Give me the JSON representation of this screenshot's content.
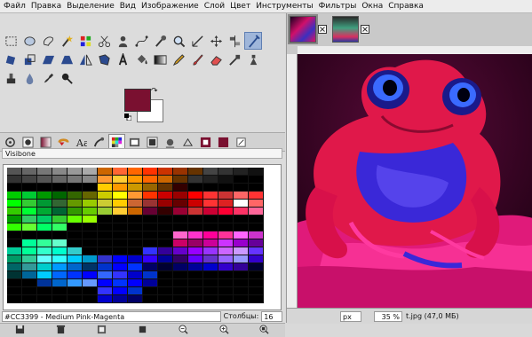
{
  "menubar": {
    "items": [
      "Файл",
      "Правка",
      "Выделение",
      "Вид",
      "Изображение",
      "Слой",
      "Цвет",
      "Инструменты",
      "Фильтры",
      "Окна",
      "Справка"
    ]
  },
  "colors": {
    "foreground": "#7a1030",
    "background": "#ffffff",
    "active_tool_highlight": "#9fb6da"
  },
  "toolbox": {
    "row1_icons": [
      "rect-select-icon",
      "ellipse-select-icon",
      "free-select-icon",
      "fuzzy-select-icon",
      "select-by-color-icon",
      "scissors-icon",
      "foreground-select-icon",
      "paths-icon",
      "color-picker-icon",
      "zoom-icon",
      "measure-icon",
      "move-icon",
      "align-icon",
      "crop-icon"
    ],
    "row2_icons": [
      "rotate-icon",
      "scale-icon",
      "shear-icon",
      "perspective-icon",
      "flip-icon",
      "cage-icon",
      "text-icon",
      "bucket-fill-icon",
      "blend-icon",
      "pencil-icon",
      "paintbrush-icon",
      "eraser-icon",
      "airbrush-icon",
      "ink-icon"
    ],
    "row3_icons": [
      "clone-icon",
      "heal-icon",
      "smudge-icon",
      "dodge-burn-icon"
    ]
  },
  "dock_tabs": [
    "tool-options-tab",
    "brushes-tab",
    "patterns-tab",
    "gradients-tab",
    "palettes-tab",
    "fonts-tab",
    "document-history-tab",
    "images-tab",
    "channels-tab",
    "layers-tab",
    "paths-tab",
    "undo-tab",
    "colors-tab",
    "pointer-tab",
    "sample-points-tab"
  ],
  "palette": {
    "name": "Visibone",
    "selected_color_name": "#CC3399 - Medium Pink-Magenta",
    "columns_label": "Столбцы:",
    "columns_value": "16",
    "columns_count": 17,
    "colors": [
      "#555555",
      "#666666",
      "#777777",
      "#888888",
      "#999999",
      "#aaaaaa",
      "#cc6600",
      "#ff6633",
      "#ff6600",
      "#ff3300",
      "#cc3300",
      "#993300",
      "#663300",
      "#444444",
      "#333333",
      "#222222",
      "#111111",
      "#333333",
      "#444444",
      "#555555",
      "#666666",
      "#777777",
      "#888888",
      "#ff9933",
      "#ffcc33",
      "#ff9900",
      "#ff6600",
      "#cc6600",
      "#663300",
      "#333333",
      "#222222",
      "#111111",
      "#000000",
      "#000000",
      "#000000",
      "#000000",
      "#000000",
      "#000000",
      "#000000",
      "#000000",
      "#ffcc00",
      "#ff9900",
      "#cc9900",
      "#996600",
      "#663300",
      "#330000",
      "#000000",
      "#000000",
      "#000000",
      "#000000",
      "#000000",
      "#00cc00",
      "#00cc33",
      "#009900",
      "#006600",
      "#336600",
      "#666600",
      "#cccc00",
      "#ffff00",
      "#ff9933",
      "#ff3300",
      "#cc0000",
      "#990000",
      "#ff0000",
      "#ff3333",
      "#cc3333",
      "#ff6666",
      "#ff3333",
      "#00ff00",
      "#33cc33",
      "#009933",
      "#336633",
      "#669900",
      "#99cc00",
      "#cccc33",
      "#ffcc00",
      "#cc6633",
      "#993333",
      "#990000",
      "#660000",
      "#cc0000",
      "#ff3333",
      "#dd2222",
      "#ffffff",
      "#ff6666",
      "#33cc00",
      "#00ff33",
      "#00aa33",
      "#006633",
      "#339900",
      "#66cc00",
      "#99cc33",
      "#ffcc33",
      "#cc6600",
      "#660033",
      "#330000",
      "#990033",
      "#cc3333",
      "#cc0033",
      "#ff0033",
      "#ff3366",
      "#ff6699",
      "#009900",
      "#33cc66",
      "#00cc66",
      "#33cc33",
      "#66ff00",
      "#99ff00",
      "#000000",
      "#000000",
      "#000000",
      "#000000",
      "#000000",
      "#000000",
      "#000000",
      "#000000",
      "#000000",
      "#000000",
      "#000000",
      "#33ff00",
      "#66ff33",
      "#00ff66",
      "#33ff66",
      "#000000",
      "#000000",
      "#000000",
      "#000000",
      "#000000",
      "#000000",
      "#000000",
      "#000000",
      "#000000",
      "#000000",
      "#000000",
      "#000000",
      "#000000",
      "#000000",
      "#000000",
      "#000000",
      "#000000",
      "#000000",
      "#000000",
      "#000000",
      "#000000",
      "#000000",
      "#000000",
      "#000000",
      "#ff66cc",
      "#ff33cc",
      "#ff0099",
      "#ff3399",
      "#ff66ff",
      "#cc33cc",
      "#000000",
      "#00ff99",
      "#33ff99",
      "#66ffcc",
      "#000000",
      "#000000",
      "#000000",
      "#000000",
      "#000000",
      "#000000",
      "#000000",
      "#cc0066",
      "#990066",
      "#cc0099",
      "#cc33ff",
      "#9900cc",
      "#660099",
      "#00cc99",
      "#00ff99",
      "#33ffcc",
      "#00ffcc",
      "#33cccc",
      "#000000",
      "#000000",
      "#000000",
      "#000000",
      "#3333ff",
      "#330099",
      "#6600cc",
      "#9900ff",
      "#9933ff",
      "#cc66ff",
      "#cc99ff",
      "#6633ff",
      "#009966",
      "#33cc99",
      "#66ffff",
      "#33ffff",
      "#00ccff",
      "#0099cc",
      "#3333cc",
      "#0000ff",
      "#0000cc",
      "#3300ff",
      "#000099",
      "#330066",
      "#6600ff",
      "#6633cc",
      "#9966ff",
      "#9999ff",
      "#3300cc",
      "#006666",
      "#339999",
      "#00cccc",
      "#0099ff",
      "#0066cc",
      "#003366",
      "#0033cc",
      "#0000ff",
      "#0033ff",
      "#000066",
      "#000033",
      "#000066",
      "#000099",
      "#0000cc",
      "#3300cc",
      "#330099",
      "#000033",
      "#003333",
      "#006699",
      "#00ccff",
      "#0066ff",
      "#0033ff",
      "#0000ff",
      "#3366ff",
      "#3333ff",
      "#0000cc",
      "#0033cc",
      "#000000",
      "#000000",
      "#000000",
      "#000000",
      "#000000",
      "#000000",
      "#000000",
      "#000000",
      "#000000",
      "#003399",
      "#0066cc",
      "#3399ff",
      "#6699ff",
      "#0000ff",
      "#0033ff",
      "#0000ff",
      "#000099",
      "#000000",
      "#000000",
      "#000000",
      "#000000",
      "#000000",
      "#000000",
      "#000000",
      "#000000",
      "#000000",
      "#000000",
      "#000000",
      "#000000",
      "#000000",
      "#3333ff",
      "#0000ff",
      "#0033cc",
      "#000000",
      "#000000",
      "#000000",
      "#000000",
      "#000000",
      "#000000",
      "#000000",
      "#000000",
      "#000000",
      "#000000",
      "#000000",
      "#000000",
      "#000000",
      "#000000",
      "#0000cc",
      "#000099",
      "#000066",
      "#000000",
      "#000000",
      "#000000",
      "#000000",
      "#000000",
      "#000000",
      "#000000",
      "#000000"
    ]
  },
  "image_window": {
    "tabs": [
      "image-tab-frog",
      "image-tab-second"
    ],
    "unit": "px",
    "zoom": "35 %",
    "info": "t.jpg (47,0 МБ)"
  }
}
